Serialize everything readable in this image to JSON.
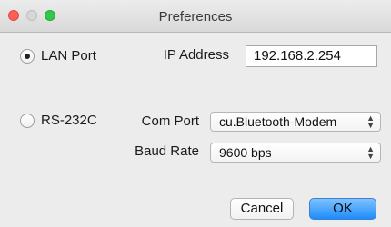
{
  "window": {
    "title": "Preferences"
  },
  "connection": {
    "lan": {
      "label": "LAN Port",
      "selected": true
    },
    "serial": {
      "label": "RS-232C",
      "selected": false
    }
  },
  "lan_settings": {
    "ip_label": "IP Address",
    "ip_value": "192.168.2.254"
  },
  "serial_settings": {
    "com_label": "Com Port",
    "com_value": "cu.Bluetooth-Modem",
    "baud_label": "Baud Rate",
    "baud_value": "9600 bps"
  },
  "buttons": {
    "cancel": "Cancel",
    "ok": "OK"
  },
  "colors": {
    "close": "#fc5f57",
    "minimize": "#d7d7d7",
    "zoom": "#32c748",
    "accent": "#1e8cfb"
  }
}
